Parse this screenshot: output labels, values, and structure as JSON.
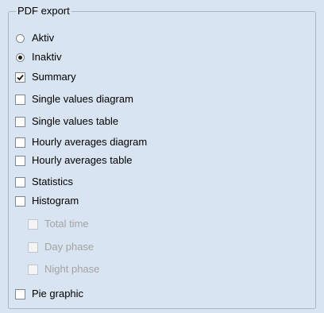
{
  "group": {
    "title": "PDF export"
  },
  "radios": [
    {
      "label": "Aktiv",
      "checked": false
    },
    {
      "label": "Inaktiv",
      "checked": true
    }
  ],
  "checkboxes": [
    {
      "label": "Summary",
      "checked": true,
      "disabled": false
    },
    {
      "label": "Single values diagram",
      "checked": false,
      "disabled": false
    },
    {
      "label": "Single values table",
      "checked": false,
      "disabled": false
    },
    {
      "label": "Hourly averages diagram",
      "checked": false,
      "disabled": false
    },
    {
      "label": "Hourly averages table",
      "checked": false,
      "disabled": false
    },
    {
      "label": "Statistics",
      "checked": false,
      "disabled": false
    },
    {
      "label": "Histogram",
      "checked": false,
      "disabled": false
    },
    {
      "label": "Total time",
      "checked": false,
      "disabled": true
    },
    {
      "label": "Day phase",
      "checked": false,
      "disabled": true
    },
    {
      "label": "Night phase",
      "checked": false,
      "disabled": true
    },
    {
      "label": "Pie graphic",
      "checked": false,
      "disabled": false
    }
  ],
  "colors": {
    "panel_background": "#d8e4f2",
    "disabled_text": "#a3a3a3"
  }
}
